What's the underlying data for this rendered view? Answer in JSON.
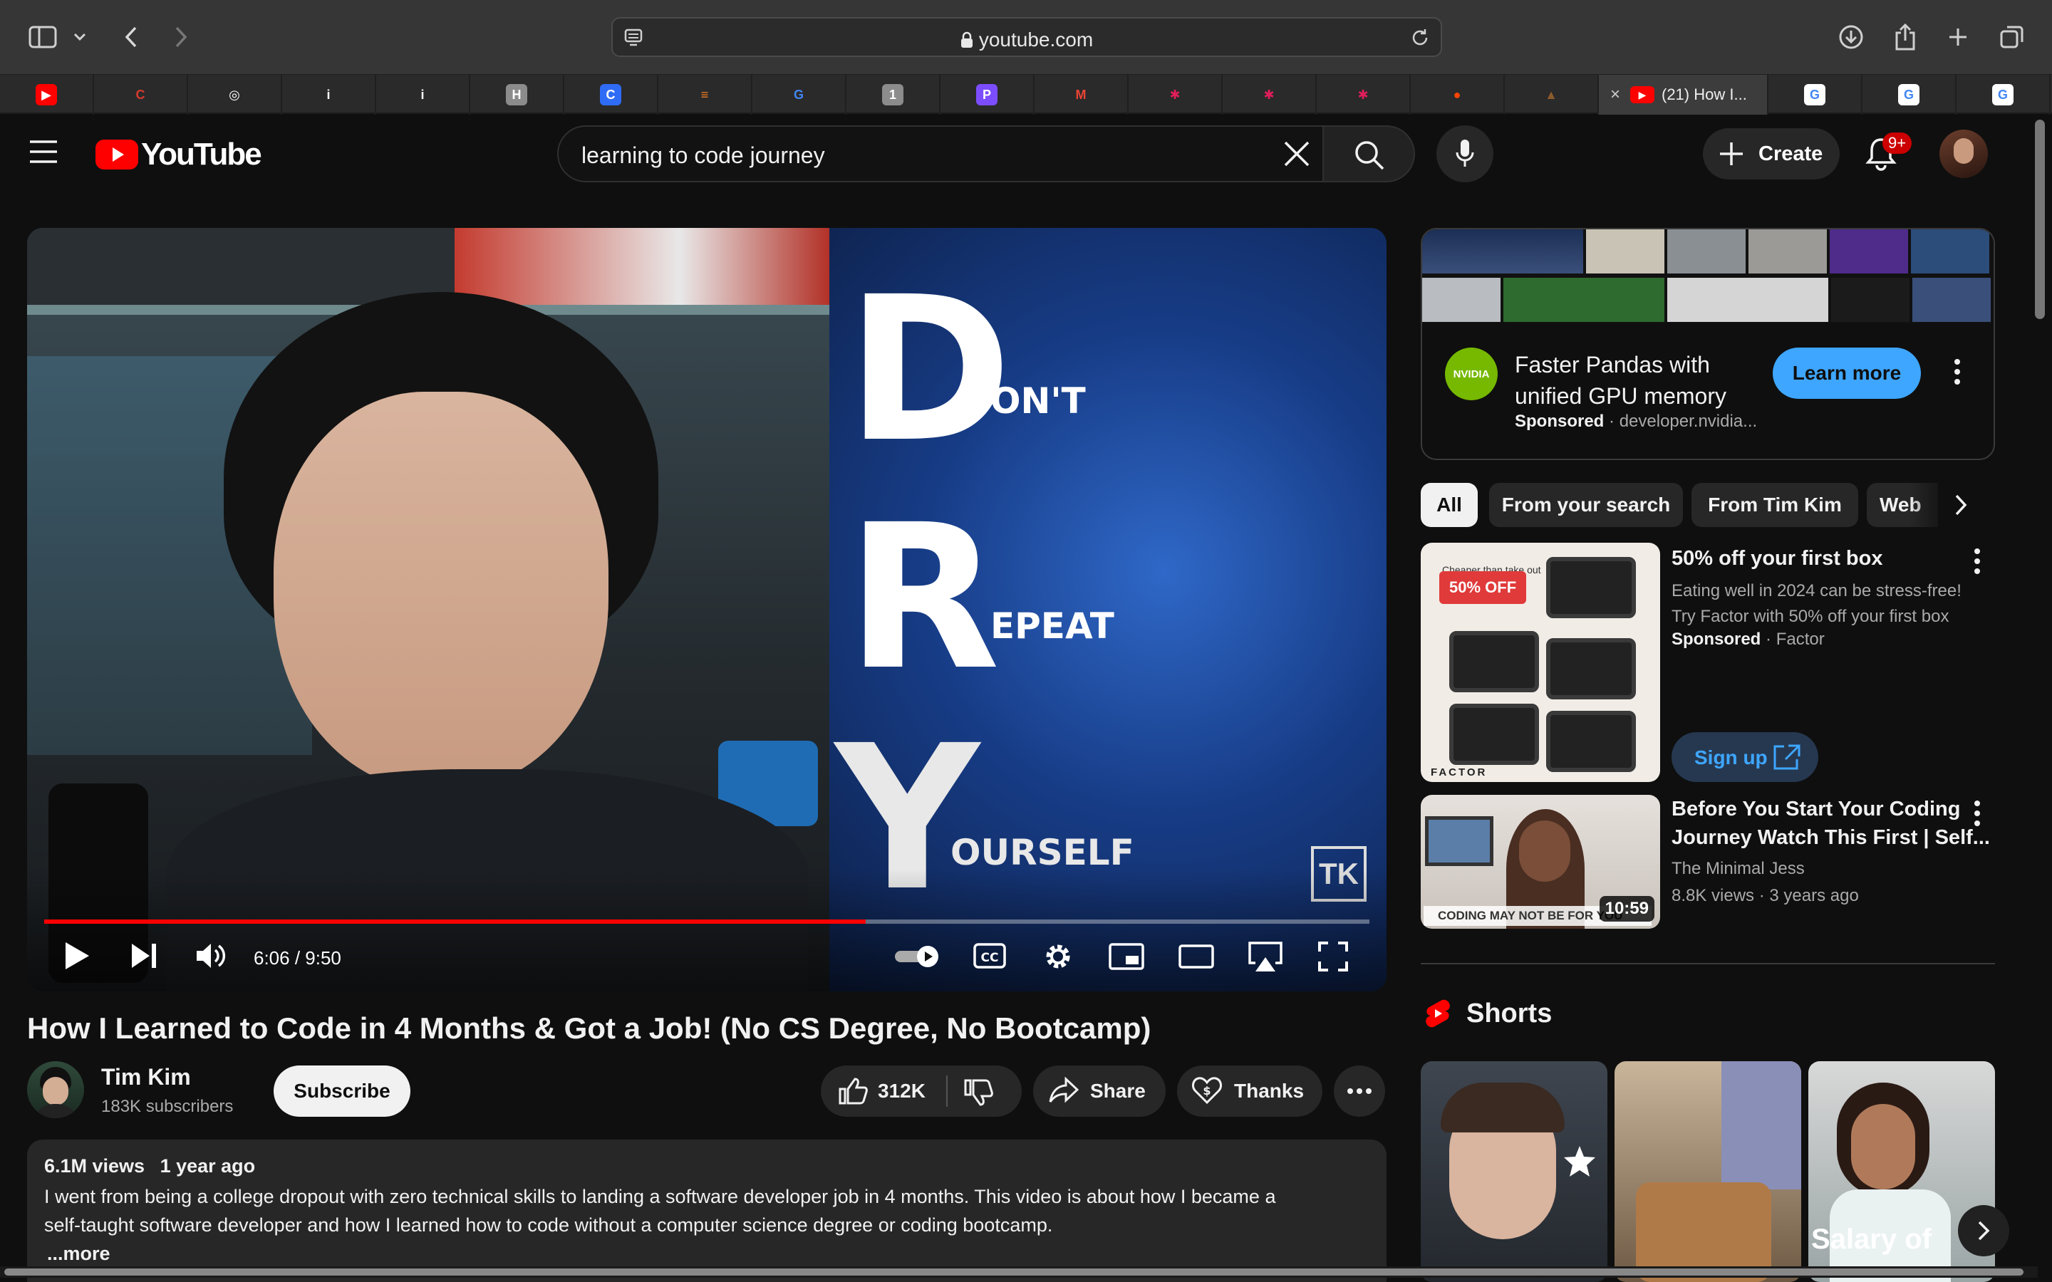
{
  "browser": {
    "url": "youtube.com",
    "active_tab_title": "(21) How I...",
    "tabs": [
      {
        "icon": "youtube-favicon-icon",
        "color": "#ff0000"
      },
      {
        "icon": "code-dose-favicon-icon",
        "color": "#d63a2f"
      },
      {
        "icon": "chatgpt-favicon-icon",
        "color": "#ffffff"
      },
      {
        "icon": "info-favicon-icon",
        "color": "#ffffff"
      },
      {
        "icon": "info-favicon-icon",
        "color": "#ffffff"
      },
      {
        "icon": "h-favicon-icon",
        "color": "#8c8c8c"
      },
      {
        "icon": "canva-favicon-icon",
        "color": "#2f6cf6"
      },
      {
        "icon": "stack-favicon-icon",
        "color": "#f48024"
      },
      {
        "icon": "google-favicon-icon",
        "color": "#4285f4"
      },
      {
        "icon": "onepassword-favicon-icon",
        "color": "#8c8c8c"
      },
      {
        "icon": "p-favicon-icon",
        "color": "#7c4dff"
      },
      {
        "icon": "gmail-favicon-icon",
        "color": "#ea4335"
      },
      {
        "icon": "slack-favicon-icon",
        "color": "#e01e5a"
      },
      {
        "icon": "slack-favicon-icon",
        "color": "#e01e5a"
      },
      {
        "icon": "slack-favicon-icon",
        "color": "#e01e5a"
      },
      {
        "icon": "reddit-favicon-icon",
        "color": "#ff4500"
      },
      {
        "icon": "poop-favicon-icon",
        "color": "#8b5a2b"
      }
    ],
    "tabs_after": [
      {
        "icon": "google-favicon-icon"
      },
      {
        "icon": "google-favicon-icon"
      },
      {
        "icon": "google-favicon-icon"
      }
    ]
  },
  "header": {
    "logo_text": "YouTube",
    "search_value": "learning to code journey",
    "create_label": "Create",
    "notification_count": "9+"
  },
  "player": {
    "thumb_d": "D",
    "thumb_ont": "ON'T",
    "thumb_r": "R",
    "thumb_epeat": "EPEAT",
    "thumb_y": "Y",
    "thumb_ourself": "OURSELF",
    "watermark": "TK",
    "time": "6:06 / 9:50",
    "progress_fraction": 0.62
  },
  "video": {
    "title": "How I Learned to Code in 4 Months & Got a Job! (No CS Degree, No Bootcamp)",
    "channel": "Tim Kim",
    "subscribers": "183K subscribers",
    "subscribe_label": "Subscribe",
    "likes": "312K",
    "share_label": "Share",
    "thanks_label": "Thanks",
    "views": "6.1M views",
    "age": "1 year ago",
    "description_line1": "I went from being a college dropout with zero technical skills to landing a software developer job in 4 months. This video is about how I became a",
    "description_line2": "self-taught software developer and how I learned how to code without a computer science degree or coding bootcamp.",
    "more_label": "...more"
  },
  "sidebar": {
    "ad": {
      "title_line1": "Faster Pandas with",
      "title_line2": "unified GPU memory",
      "sponsored": "Sponsored",
      "domain": "developer.nvidia...",
      "cta": "Learn more",
      "logo_text": "NVIDIA"
    },
    "chips": [
      "All",
      "From your search",
      "From Tim Kim",
      "Web"
    ],
    "promo": {
      "title": "50% off your first box",
      "desc_line1": "Eating well in 2024 can be stress-free!",
      "desc_line2": "Try Factor with 50% off your first box",
      "sponsored": "Sponsored",
      "advertiser": "Factor",
      "cta": "Sign up",
      "thumb_badge": "50% OFF",
      "thumb_small": "Cheaper than take out",
      "thumb_brand": "FACTOR"
    },
    "rec": {
      "title_line1": "Before You Start Your Coding",
      "title_line2": "Journey Watch This First | Self...",
      "channel": "The Minimal Jess",
      "views": "8.8K views",
      "age": "3 years ago",
      "duration": "10:59",
      "thumb_caption": "CODING MAY NOT BE FOR YOU"
    },
    "shorts_title": "Shorts",
    "shorts_caption": "Salary of"
  },
  "colors": {
    "yt_red": "#ff0000",
    "learn_more_bg": "#3ea6ff",
    "sign_up_text": "#3ea6ff",
    "nvidia_green": "#76b900"
  }
}
